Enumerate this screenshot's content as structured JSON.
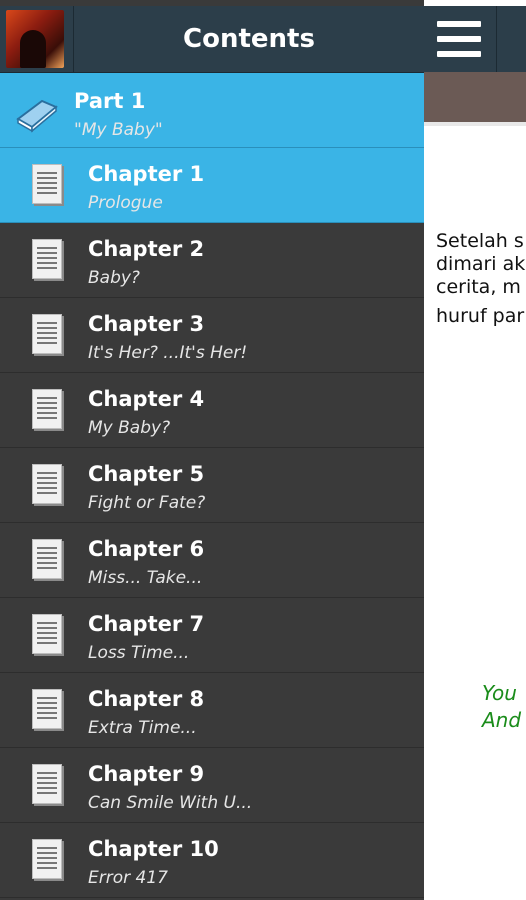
{
  "drawer": {
    "title": "Contents",
    "cover_icon": "book-cover-image",
    "part": {
      "label": "Part 1",
      "subtitle": "\"My Baby\"",
      "icon": "book-icon"
    },
    "chapters": [
      {
        "label": "Chapter 1",
        "subtitle": "Prologue",
        "selected": true
      },
      {
        "label": "Chapter 2",
        "subtitle": "Baby?"
      },
      {
        "label": "Chapter 3",
        "subtitle": "It's Her? ...It's Her!"
      },
      {
        "label": "Chapter 4",
        "subtitle": "My Baby?"
      },
      {
        "label": "Chapter 5",
        "subtitle": "Fight or Fate?"
      },
      {
        "label": "Chapter 6",
        "subtitle": "Miss... Take..."
      },
      {
        "label": "Chapter 7",
        "subtitle": "Loss Time..."
      },
      {
        "label": "Chapter 8",
        "subtitle": "Extra Time..."
      },
      {
        "label": "Chapter 9",
        "subtitle": "Can Smile With U..."
      },
      {
        "label": "Chapter 10",
        "subtitle": "Error 417"
      }
    ]
  },
  "main": {
    "menu_icon": "hamburger-menu-icon",
    "text_lines": [
      "Setelah s",
      "dimari ak",
      "cerita, m",
      "huruf par"
    ],
    "green_lines": [
      "You",
      "And"
    ]
  },
  "colors": {
    "header_bg": "#2c3e4a",
    "selected_bg": "#3ab4e6",
    "drawer_bg": "#3a3a3a",
    "green_text": "#1a8c1a"
  }
}
